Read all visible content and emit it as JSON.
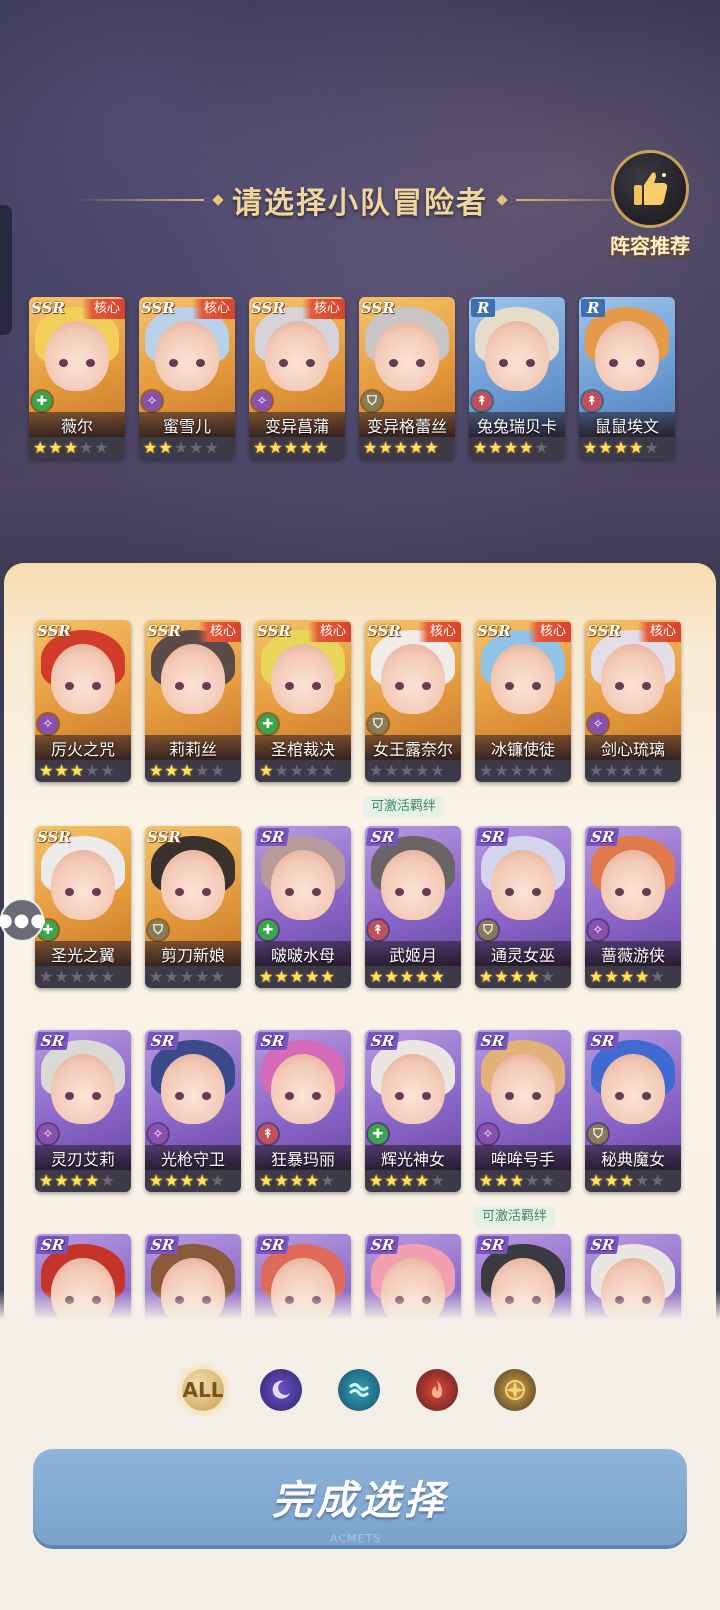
{
  "header": {
    "title": "请选择小队冒险者"
  },
  "recommend": {
    "label": "阵容推荐",
    "icon": "thumbs-up-icon"
  },
  "selected_team": [
    {
      "name": "薇尔",
      "rarity": "SSR",
      "core": "核心",
      "role": "healer",
      "stars": 3,
      "hair": "#f3cf5a"
    },
    {
      "name": "蜜雪儿",
      "rarity": "SSR",
      "core": "核心",
      "role": "mage",
      "stars": 2,
      "hair": "#b9d2ea"
    },
    {
      "name": "变异菖蒲",
      "rarity": "SSR",
      "core": "核心",
      "role": "mage",
      "stars": 5,
      "hair": "#d6d4d8"
    },
    {
      "name": "变异格蕾丝",
      "rarity": "SSR",
      "core": "",
      "role": "tank",
      "stars": 5,
      "hair": "#c9c4c6"
    },
    {
      "name": "兔兔瑞贝卡",
      "rarity": "R",
      "core": "",
      "role": "dps",
      "stars": 4,
      "hair": "#e6dccb"
    },
    {
      "name": "鼠鼠埃文",
      "rarity": "R",
      "core": "",
      "role": "dps",
      "stars": 4,
      "hair": "#e59a4a"
    }
  ],
  "roster": [
    {
      "name": "厉火之咒",
      "rarity": "SSR",
      "core": "",
      "role": "mage",
      "stars": 3,
      "hair": "#d23a2a"
    },
    {
      "name": "莉莉丝",
      "rarity": "SSR",
      "core": "核心",
      "role": "",
      "stars": 3,
      "hair": "#5a4a48"
    },
    {
      "name": "圣棺裁决",
      "rarity": "SSR",
      "core": "核心",
      "role": "healer",
      "stars": 1,
      "hair": "#e8d65a"
    },
    {
      "name": "女王露奈尔",
      "rarity": "SSR",
      "core": "核心",
      "role": "tank",
      "stars": 0,
      "hair": "#f0ece8"
    },
    {
      "name": "冰镰使徒",
      "rarity": "SSR",
      "core": "核心",
      "role": "",
      "stars": 0,
      "hair": "#8fc4e8"
    },
    {
      "name": "剑心琉璃",
      "rarity": "SSR",
      "core": "核心",
      "role": "mage",
      "stars": 0,
      "hair": "#e4dce6"
    },
    {
      "name": "圣光之翼",
      "rarity": "SSR",
      "core": "",
      "role": "healer",
      "stars": 0,
      "hair": "#eceaea"
    },
    {
      "name": "剪刀新娘",
      "rarity": "SSR",
      "core": "",
      "role": "tank",
      "stars": 0,
      "hair": "#3a302c"
    },
    {
      "name": "啵啵水母",
      "rarity": "SR",
      "core": "",
      "role": "healer",
      "stars": 5,
      "hair": "#b89a9a"
    },
    {
      "name": "武姬月",
      "rarity": "SR",
      "core": "",
      "role": "dps",
      "stars": 5,
      "hair": "#6a6466"
    },
    {
      "name": "通灵女巫",
      "rarity": "SR",
      "core": "",
      "role": "tank",
      "stars": 4,
      "hair": "#d4d4ec"
    },
    {
      "name": "蔷薇游侠",
      "rarity": "SR",
      "core": "",
      "role": "mage",
      "stars": 4,
      "hair": "#e07a4a"
    },
    {
      "name": "灵刃艾莉",
      "rarity": "SR",
      "core": "",
      "role": "mage",
      "stars": 4,
      "hair": "#d9dad4"
    },
    {
      "name": "光枪守卫",
      "rarity": "SR",
      "core": "",
      "role": "mage",
      "stars": 4,
      "hair": "#3a4a8a"
    },
    {
      "name": "狂暴玛丽",
      "rarity": "SR",
      "core": "",
      "role": "dps",
      "stars": 4,
      "hair": "#d46ab8"
    },
    {
      "name": "辉光神女",
      "rarity": "SR",
      "core": "",
      "role": "healer",
      "stars": 4,
      "hair": "#ece6e2"
    },
    {
      "name": "哞哞号手",
      "rarity": "SR",
      "core": "",
      "role": "mage",
      "stars": 3,
      "hair": "#e2b27a"
    },
    {
      "name": "秘典魔女",
      "rarity": "SR",
      "core": "",
      "role": "tank",
      "stars": 3,
      "hair": "#3f6ad0"
    },
    {
      "name": "",
      "rarity": "SR",
      "core": "",
      "role": "",
      "stars": -1,
      "hair": "#c4342a"
    },
    {
      "name": "",
      "rarity": "SR",
      "core": "",
      "role": "",
      "stars": -1,
      "hair": "#8a5a3a"
    },
    {
      "name": "",
      "rarity": "SR",
      "core": "",
      "role": "",
      "stars": -1,
      "hair": "#e06a5a"
    },
    {
      "name": "",
      "rarity": "SR",
      "core": "",
      "role": "",
      "stars": -1,
      "hair": "#f0a0b0"
    },
    {
      "name": "",
      "rarity": "SR",
      "core": "",
      "role": "",
      "stars": -1,
      "hair": "#3a3a40"
    },
    {
      "name": "",
      "rarity": "SR",
      "core": "",
      "role": "",
      "stars": -1,
      "hair": "#eae6e2"
    }
  ],
  "bond_labels": [
    "可激活羁绊",
    "可激活羁绊"
  ],
  "filters": [
    {
      "label": "ALL",
      "icon": "all-filter-icon"
    },
    {
      "label": "",
      "icon": "moon-element-icon"
    },
    {
      "label": "",
      "icon": "water-element-icon"
    },
    {
      "label": "",
      "icon": "fire-element-icon"
    },
    {
      "label": "",
      "icon": "light-element-icon"
    }
  ],
  "confirm": {
    "label": "完成选择"
  },
  "watermark": "ACMETS",
  "colors": {
    "accent_gold": "#f2d59c",
    "button_blue": "#7aa2cc",
    "panel_bg": "#faf3e7"
  }
}
